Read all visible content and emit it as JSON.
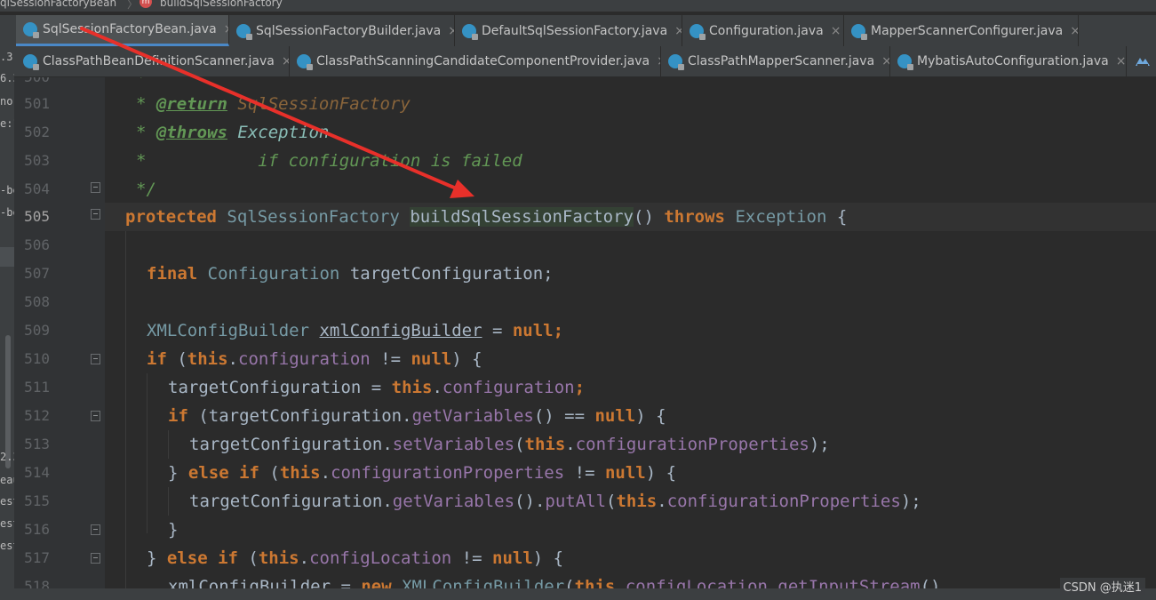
{
  "breadcrumb": {
    "class_name": "qlSessionFactoryBean",
    "method_icon": "m",
    "method_name": "buildSqlSessionFactory"
  },
  "tabs_row1": [
    {
      "label": "SqlSessionFactoryBean.java",
      "icon": "class-icon",
      "active": true
    },
    {
      "label": "SqlSessionFactoryBuilder.java",
      "icon": "class-icon",
      "active": false
    },
    {
      "label": "DefaultSqlSessionFactory.java",
      "icon": "class-icon",
      "active": false
    },
    {
      "label": "Configuration.java",
      "icon": "class-icon",
      "active": false
    },
    {
      "label": "MapperScannerConfigurer.java",
      "icon": "class-icon",
      "active": false
    }
  ],
  "tabs_row2": [
    {
      "label": "ClassPathBeanDefinitionScanner.java",
      "icon": "class-icon"
    },
    {
      "label": "ClassPathScanningCandidateComponentProvider.java",
      "icon": "class-icon"
    },
    {
      "label": "ClassPathMapperScanner.java",
      "icon": "class-icon"
    },
    {
      "label": "MybatisAutoConfiguration.java",
      "icon": "class-icon"
    }
  ],
  "close_glyph": "×",
  "left_panel_fragments": [
    ".3",
    "6.3",
    "nor",
    "e:1",
    "-be",
    "-be",
    "2.3",
    "eau",
    "esta",
    "esta",
    "esta"
  ],
  "line_numbers": [
    "500",
    "501",
    "502",
    "503",
    "504",
    "505",
    "506",
    "507",
    "508",
    "509",
    "510",
    "511",
    "512",
    "513",
    "514",
    "515",
    "516",
    "517",
    "518"
  ],
  "current_line": "505",
  "code": {
    "l500": "*",
    "l501_star": "* ",
    "l501_tag": "@return",
    "l501_rest": " SqlSessionFactory",
    "l502_star": "* ",
    "l502_tag": "@throws",
    "l502_rest": " Exception",
    "l503": "*           if configuration is failed",
    "l504": "*/",
    "l505_kw": "protected",
    "l505_type": "SqlSessionFactory",
    "l505_method": "buildSqlSessionFactory",
    "l505_paren": "()",
    "l505_throws": "throws",
    "l505_exc": "Exception",
    "l505_brace": "{",
    "l507_kw": "final",
    "l507_type": "Configuration",
    "l507_rest": " targetConfiguration;",
    "l509_type": "XMLConfigBuilder",
    "l509_var": "xmlConfigBuilder",
    "l509_eq": " = ",
    "l509_null": "null",
    "l509_end": ";",
    "l510_if": "if",
    "l510_a": " (",
    "l510_this": "this",
    "l510_dot": ".",
    "l510_field": "configuration",
    "l510_op": " != ",
    "l510_null": "null",
    "l510_end": ") {",
    "l511_a": "targetConfiguration = ",
    "l511_this": "this",
    "l511_dot": ".",
    "l511_field": "configuration",
    "l511_end": ";",
    "l512_if": "if",
    "l512_a": " (targetConfiguration.",
    "l512_m": "getVariables",
    "l512_b": "() == ",
    "l512_null": "null",
    "l512_end": ") {",
    "l513_a": "targetConfiguration.",
    "l513_m": "setVariables",
    "l513_b": "(",
    "l513_this": "this",
    "l513_dot": ".",
    "l513_field": "configurationProperties",
    "l513_end": ");",
    "l514_a": "} ",
    "l514_else": "else if",
    "l514_b": " (",
    "l514_this": "this",
    "l514_dot": ".",
    "l514_field": "configurationProperties",
    "l514_op": " != ",
    "l514_null": "null",
    "l514_end": ") {",
    "l515_a": "targetConfiguration.",
    "l515_m": "getVariables",
    "l515_b": "().",
    "l515_m2": "putAll",
    "l515_c": "(",
    "l515_this": "this",
    "l515_dot": ".",
    "l515_field": "configurationProperties",
    "l515_end": ");",
    "l516": "}",
    "l517_a": "} ",
    "l517_else": "else if",
    "l517_b": " (",
    "l517_this": "this",
    "l517_dot": ".",
    "l517_field": "configLocation",
    "l517_op": " != ",
    "l517_null": "null",
    "l517_end": ") {",
    "l518_a": "xmlConfigBuilder = ",
    "l518_new": "new",
    "l518_type": " XMLConfigBuilder",
    "l518_b": "(",
    "l518_this": "this",
    "l518_dot": ".",
    "l518_field": "configLocation",
    "l518_c": ".",
    "l518_m": "getInputStream",
    "l518_end": "(),"
  },
  "watermark": "CSDN @执迷1",
  "colors": {
    "editor_bg": "#2b2b2b",
    "keyword": "#cc7832",
    "field": "#9876aa",
    "comment": "#629755",
    "annotation_arrow": "#e8302a",
    "active_tab_underline": "#4a88c7"
  }
}
